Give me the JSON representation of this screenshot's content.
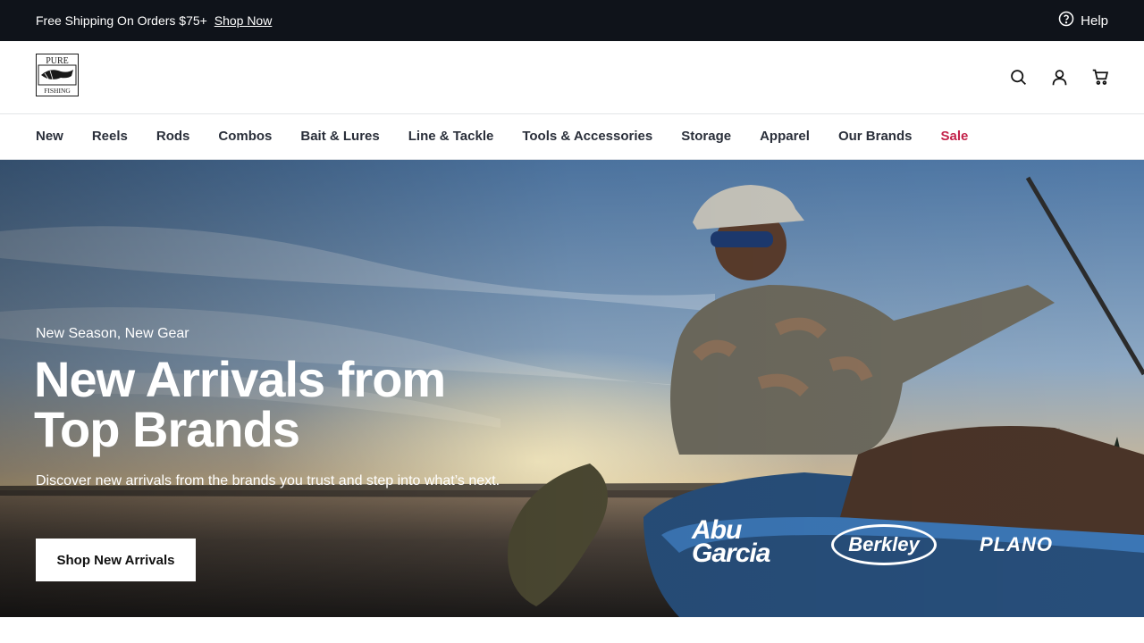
{
  "announcement": {
    "promo_text": "Free Shipping On Orders $75+",
    "promo_link": "Shop Now",
    "help_label": "Help",
    "help_icon": "question-circle-icon"
  },
  "header": {
    "logo_top": "PURE",
    "logo_bottom": "FISHING",
    "icons": [
      "search-icon",
      "account-icon",
      "cart-icon"
    ]
  },
  "nav": {
    "items": [
      {
        "label": "New"
      },
      {
        "label": "Reels"
      },
      {
        "label": "Rods"
      },
      {
        "label": "Combos"
      },
      {
        "label": "Bait & Lures"
      },
      {
        "label": "Line & Tackle"
      },
      {
        "label": "Tools & Accessories"
      },
      {
        "label": "Storage"
      },
      {
        "label": "Apparel"
      },
      {
        "label": "Our Brands"
      },
      {
        "label": "Sale"
      }
    ],
    "sale_color": "#c3224a"
  },
  "hero": {
    "eyebrow": "New Season, New Gear",
    "title": "New Arrivals from Top Brands",
    "description": "Discover new arrivals from the brands you trust and step into what’s next.",
    "cta_label": "Shop New Arrivals",
    "brands": [
      "Abu Garcia",
      "Berkley",
      "PLANO"
    ]
  },
  "colors": {
    "topbar": "#0f131a",
    "accent_sale": "#c3224a"
  }
}
